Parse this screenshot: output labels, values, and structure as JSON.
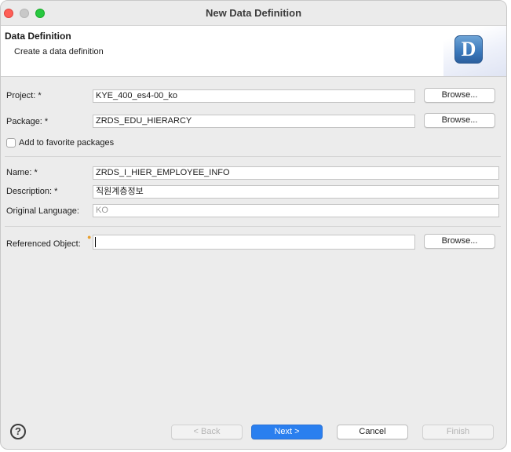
{
  "window": {
    "title": "New Data Definition"
  },
  "header": {
    "title": "Data Definition",
    "subtitle": "Create a data definition",
    "logo_letter": "D"
  },
  "form": {
    "project": {
      "label": "Project: *",
      "value": "KYE_400_es4-00_ko",
      "browse": "Browse..."
    },
    "package": {
      "label": "Package: *",
      "value": "ZRDS_EDU_HIERARCY",
      "browse": "Browse..."
    },
    "favorite": {
      "label": "Add to favorite packages",
      "checked": false
    },
    "name": {
      "label": "Name: *",
      "value": "ZRDS_I_HIER_EMPLOYEE_INFO"
    },
    "description": {
      "label": "Description: *",
      "value": "직원계층정보"
    },
    "original_language": {
      "label": "Original Language:",
      "value": "KO"
    },
    "referenced_object": {
      "label": "Referenced Object:",
      "value": "",
      "browse": "Browse..."
    }
  },
  "footer": {
    "help_icon": "?",
    "back": "< Back",
    "next": "Next >",
    "cancel": "Cancel",
    "finish": "Finish"
  },
  "colors": {
    "primary_button": "#2a7fef",
    "close": "#fe5f57",
    "maximize": "#28c840"
  }
}
